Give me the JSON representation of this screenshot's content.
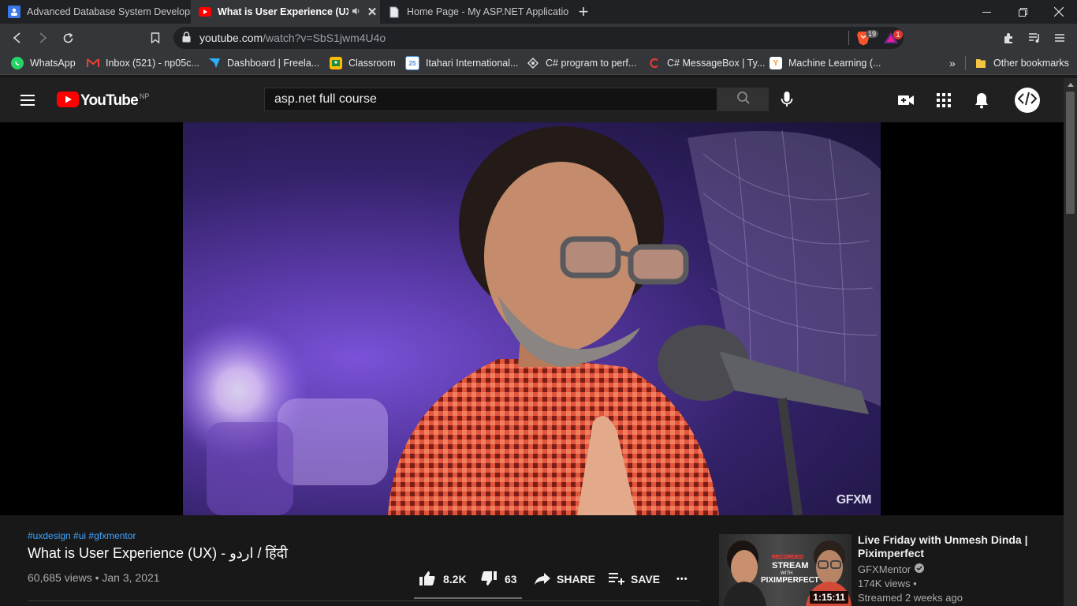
{
  "browser": {
    "tabs": [
      {
        "title": "Advanced Database System Developm",
        "active": false
      },
      {
        "title": "What is User Experience (UX)",
        "active": true
      },
      {
        "title": "Home Page - My ASP.NET Application",
        "active": false
      }
    ],
    "new_tab": "+",
    "url_host": "youtube.com",
    "url_path": "/watch?v=SbS1jwm4U4o",
    "brave_count": "19",
    "alert_count": "1",
    "bookmarks": [
      {
        "label": "WhatsApp"
      },
      {
        "label": "Inbox (521) - np05c..."
      },
      {
        "label": "Dashboard | Freela..."
      },
      {
        "label": "Classroom"
      },
      {
        "label": "Itahari International..."
      },
      {
        "label": "C# program to perf..."
      },
      {
        "label": "C# MessageBox | Ty..."
      },
      {
        "label": "Machine Learning (..."
      }
    ],
    "more_bookmarks": "»",
    "other_bookmarks": "Other bookmarks"
  },
  "youtube": {
    "logo_text": "YouTube",
    "region": "NP",
    "search_query": "asp.net full course",
    "watermark": "GFXM",
    "video": {
      "hashtags": "#uxdesign #ui #gfxmentor",
      "title": "What is User Experience (UX) - اردو / हिंदी",
      "views_date": "60,685 views • Jan 3, 2021",
      "likes": "8.2K",
      "dislikes": "63",
      "share": "SHARE",
      "save": "SAVE",
      "more": "•••"
    },
    "related": {
      "title": "Live Friday with Unmesh Dinda | Piximperfect",
      "channel": "GFXMentor",
      "views": "174K views •",
      "time": "Streamed 2 weeks ago",
      "duration": "1:15:11",
      "thumb_text_1": "RECORDED",
      "thumb_text_2": "STREAM",
      "thumb_text_3": "WITH",
      "thumb_text_4": "PIXIMPERFECT"
    }
  },
  "colors": {
    "yt_red": "#ff0000",
    "link_blue": "#3ea6ff"
  }
}
